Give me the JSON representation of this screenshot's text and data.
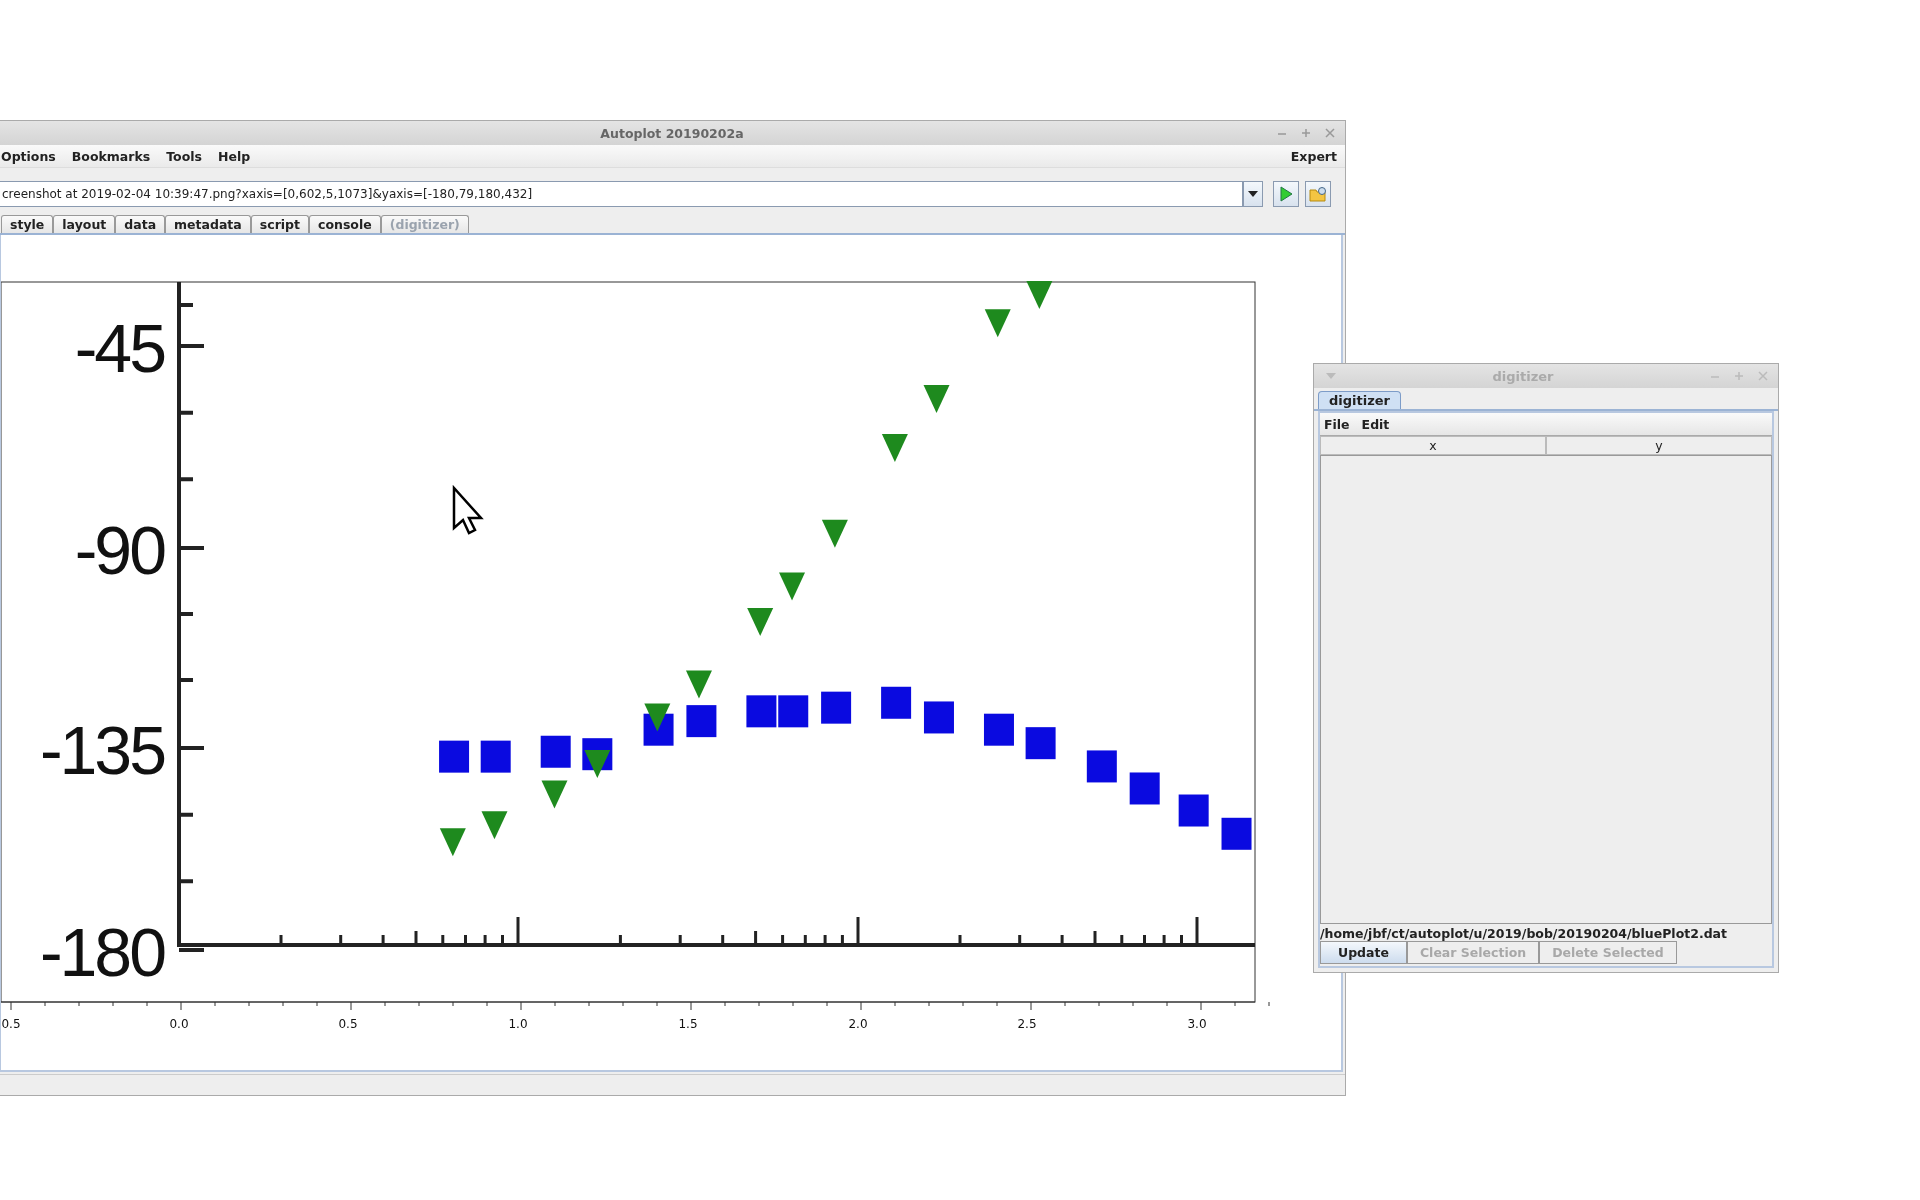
{
  "window": {
    "title": "Autoplot 20190202a"
  },
  "menu": [
    "Options",
    "Bookmarks",
    "Tools",
    "Help"
  ],
  "expert_menu": "Expert",
  "address": {
    "value": "creenshot at 2019-02-04 10:39:47.png?xaxis=[0,602,5,1073]&yaxis=[-180,79,180,432]"
  },
  "tabs": [
    {
      "label": "style",
      "disabled": false
    },
    {
      "label": "layout",
      "disabled": false
    },
    {
      "label": "data",
      "disabled": false
    },
    {
      "label": "metadata",
      "disabled": false
    },
    {
      "label": "script",
      "disabled": false
    },
    {
      "label": "console",
      "disabled": false
    },
    {
      "label": "(digitizer)",
      "disabled": true
    }
  ],
  "plot_image": {
    "y_labels": [
      "-45",
      "-90",
      "-135",
      "-180"
    ]
  },
  "x_axis": {
    "ticks": [
      "0.5",
      "0.0",
      "0.5",
      "1.0",
      "1.5",
      "2.0",
      "2.5",
      "3.0"
    ]
  },
  "digitizer": {
    "title": "digitizer",
    "tabs": [
      {
        "label": "digitizer",
        "selected": true
      }
    ],
    "menu": [
      "File",
      "Edit"
    ],
    "columns": [
      "x",
      "y"
    ],
    "path": "/home/jbf/ct/autoplot/u/2019/bob/20190204/bluePlot2.dat",
    "buttons": [
      {
        "label": "Update",
        "disabled": false
      },
      {
        "label": "Clear Selection",
        "disabled": true
      },
      {
        "label": "Delete Selected",
        "disabled": true
      }
    ]
  }
}
